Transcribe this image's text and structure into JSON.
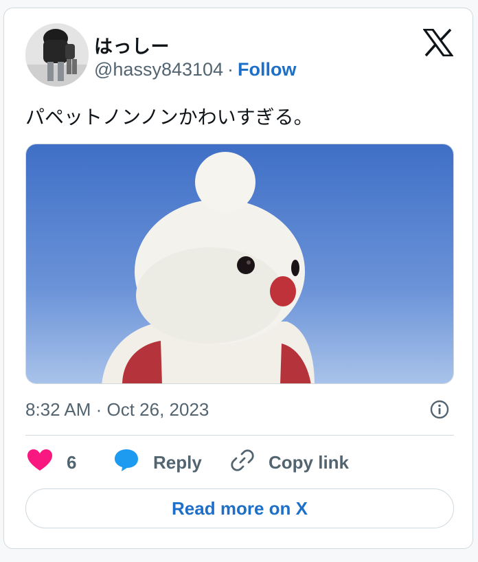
{
  "author": {
    "display_name": "はっしー",
    "handle": "@hassy843104",
    "separator": "·",
    "follow_label": "Follow"
  },
  "tweet": {
    "text": "パペットノンノンかわいすぎる。",
    "timestamp": "8:32 AM · Oct 26, 2023"
  },
  "actions": {
    "like_count": "6",
    "reply_label": "Reply",
    "copy_link_label": "Copy link"
  },
  "read_more_label": "Read more on X",
  "icons": {
    "brand": "x-logo-icon",
    "info": "info-icon",
    "like": "heart-icon",
    "reply": "speech-bubble-icon",
    "copy": "link-icon"
  },
  "colors": {
    "like": "#f91880",
    "reply": "#1d9bf0",
    "link": "#1d6fc8",
    "muted": "#536471",
    "border": "#cfd9de"
  }
}
